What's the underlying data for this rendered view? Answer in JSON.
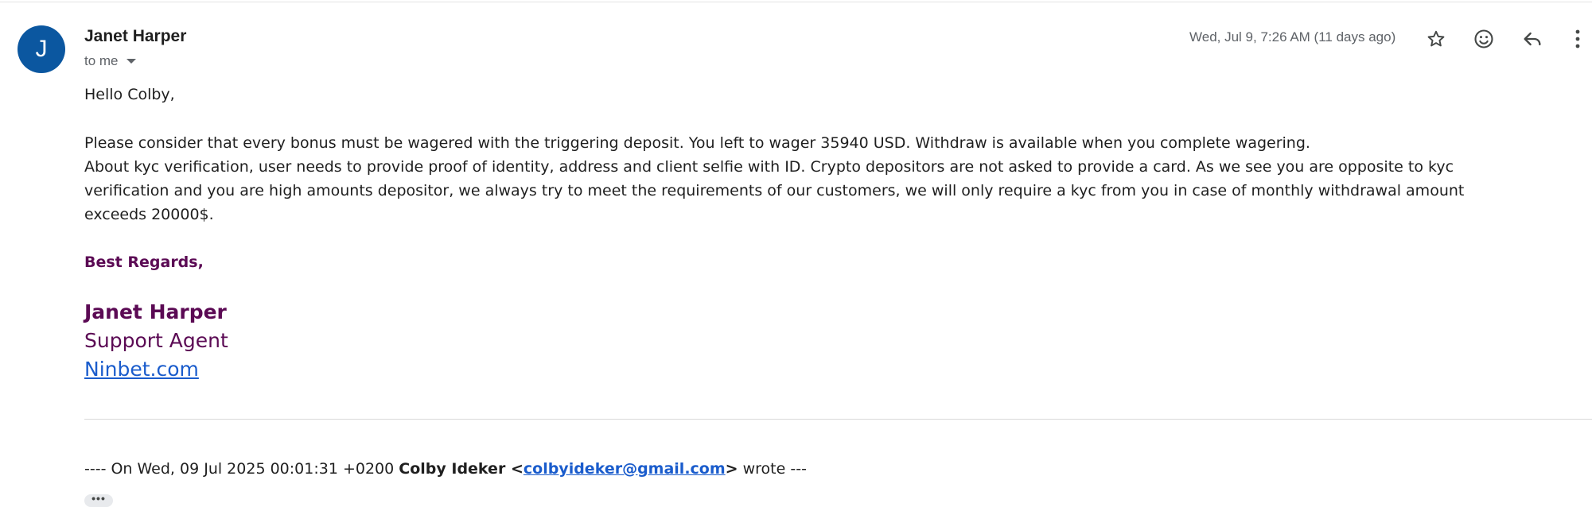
{
  "sender": {
    "avatar_letter": "J",
    "name": "Janet Harper",
    "to_label": "to me",
    "date": "Wed, Jul 9, 7:26 AM (11 days ago)"
  },
  "actions": {
    "star_icon": "star-icon",
    "emoji_icon": "emoji-icon",
    "reply_icon": "reply-icon",
    "more_icon": "more-vert-icon"
  },
  "body": {
    "greeting": "Hello Colby,",
    "line1": "Please consider that every bonus must be wagered with the triggering deposit. You left to wager 35940 USD. Withdraw is available when you complete wagering.",
    "line2": "About kyc verification, user needs to provide proof of identity, address and client selfie with ID. Crypto depositors are not asked to provide a card. As we see you are opposite to kyc",
    "line3": "verification and you are high amounts depositor, we always try to meet the requirements of our customers, we will only require a kyc from you in case of monthly withdrawal amount",
    "line4": "exceeds 20000$."
  },
  "signature": {
    "regards": "Best Regards,",
    "name": "Janet Harper",
    "role": "Support Agent",
    "link": "Ninbet.com"
  },
  "quote": {
    "prefix": "---- On Wed, 09 Jul 2025 00:01:31 +0200 ",
    "author": "Colby Ideker",
    "open_bracket": " <",
    "email": "colbyideker@gmail.com",
    "close_bracket": ">",
    "suffix": " wrote ---",
    "expand_label": "•••"
  },
  "colors": {
    "avatar": "#0b57a0",
    "signature": "#5b0a54",
    "link": "#1a5ccc"
  }
}
